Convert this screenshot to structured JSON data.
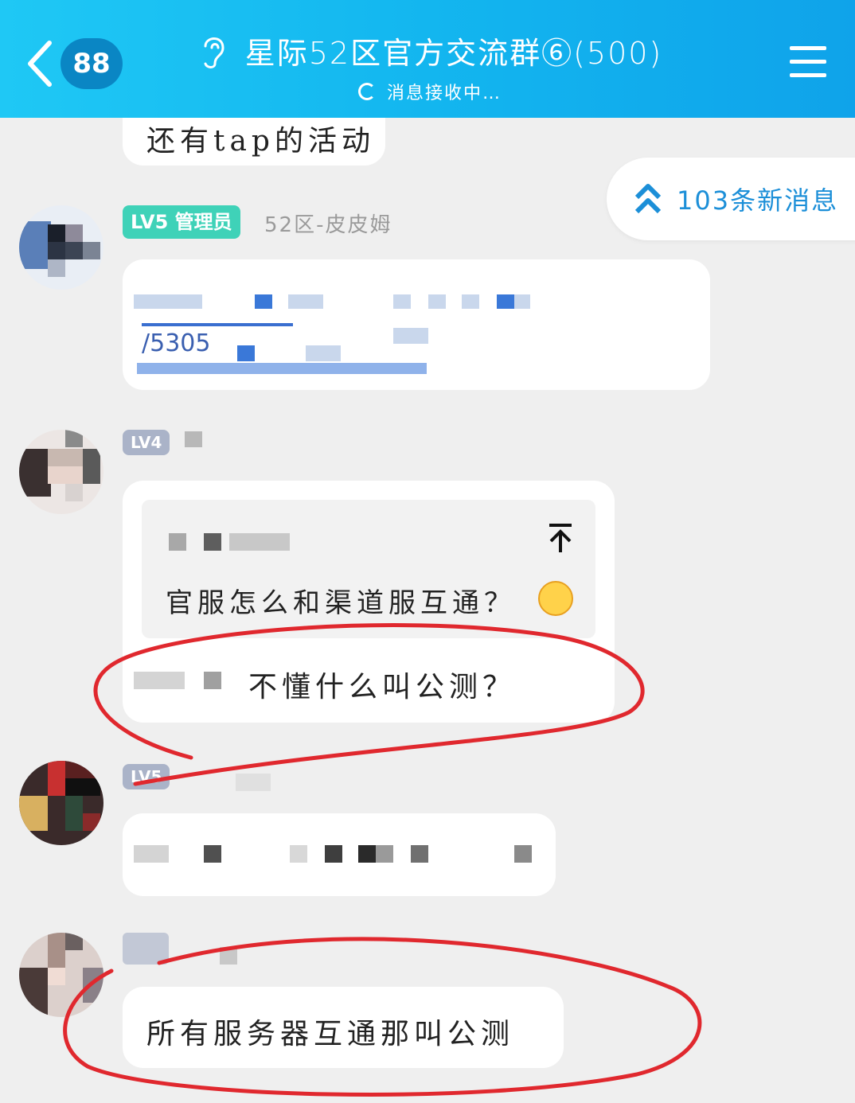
{
  "header": {
    "unread_count": "88",
    "group_name": "星际52区官方交流群⑥(500)",
    "status": "消息接收中…"
  },
  "new_messages": {
    "label": "103条新消息"
  },
  "messages": [
    {
      "text": "还有tap的活动"
    },
    {
      "level": "LV5 管理员",
      "sender": "52区-皮皮姆",
      "link_fragment": "/5305"
    },
    {
      "level": "LV4",
      "quote_text": "官服怎么和渠道服互通？",
      "text": "不懂什么叫公测？"
    },
    {
      "level": "LV5"
    },
    {
      "text": "所有服务器互通那叫公测"
    }
  ],
  "colors": {
    "header_start": "#1fc8f5",
    "header_end": "#0fa3ea",
    "admin_tag": "#3fd2b8",
    "level_tag": "#aab3c8",
    "annotation": "#e0282e",
    "accent": "#1c8fd8"
  }
}
